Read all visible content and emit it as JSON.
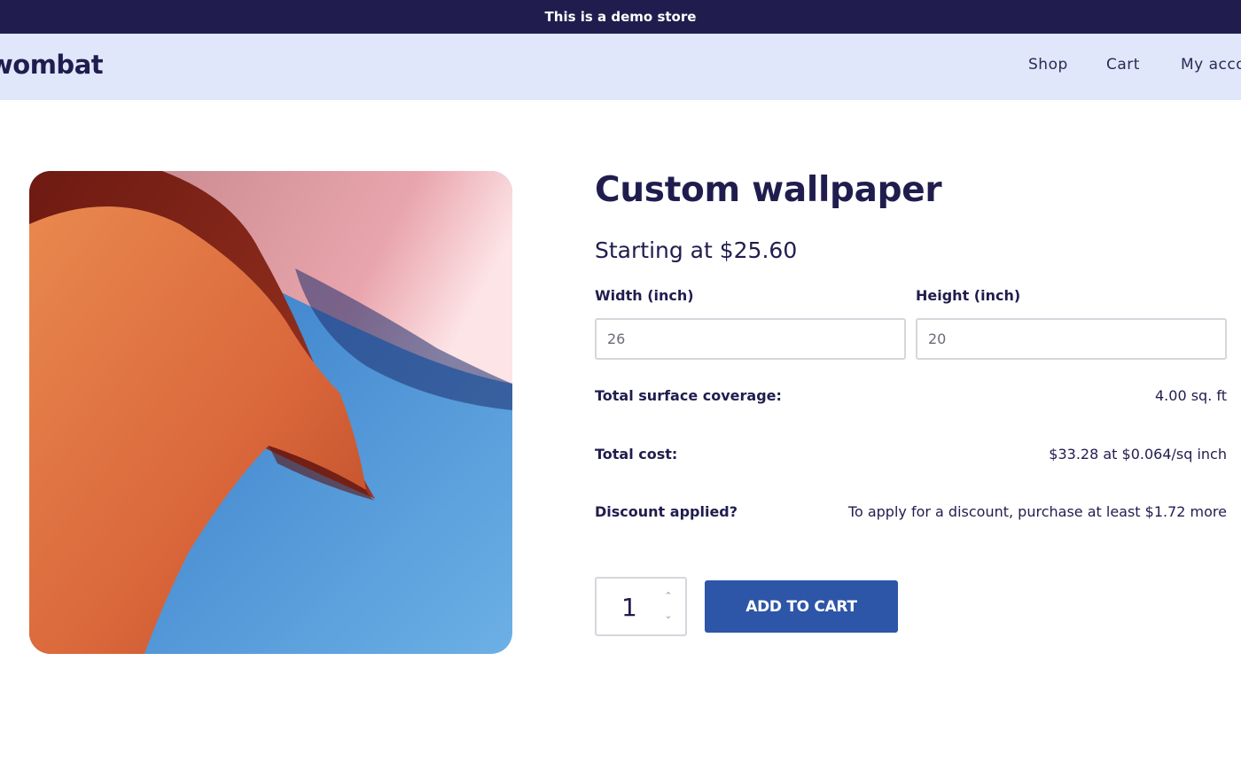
{
  "banner": {
    "text": "This is a demo store"
  },
  "header": {
    "logo": "wombat",
    "nav": [
      {
        "label": "Shop"
      },
      {
        "label": "Cart"
      },
      {
        "label": "My acco"
      }
    ]
  },
  "product": {
    "image_icon": "wallpaper-photo",
    "title": "Custom wallpaper",
    "price_text": "Starting at $25.60",
    "width": {
      "label": "Width (inch)",
      "value": "26"
    },
    "height": {
      "label": "Height (inch)",
      "value": "20"
    },
    "summary": [
      {
        "label": "Total surface coverage:",
        "value": "4.00 sq. ft"
      },
      {
        "label": "Total cost:",
        "value": "$33.28 at $0.064/sq inch"
      },
      {
        "label": "Discount applied?",
        "value": "To apply for a discount, purchase at least $1.72 more"
      }
    ],
    "quantity": "1",
    "add_to_cart_label": "ADD TO CART"
  },
  "colors": {
    "banner_bg": "#201d4e",
    "header_bg": "#e1e7fa",
    "primary_button": "#2d55a8",
    "text_dark": "#201d4e"
  }
}
